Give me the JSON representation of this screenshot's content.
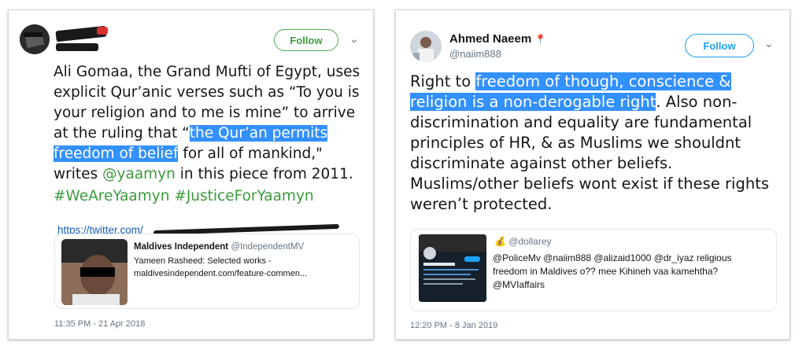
{
  "left_tweet": {
    "follow_label": "Follow",
    "text_parts": {
      "t1": "Ali Gomaa, the Grand Mufti of Egypt, uses explicit Qur’anic verses such as “To you is your religion and to me is mine” to arrive at the ruling that “",
      "highlight": "the Qur’an permits freedom of belief",
      "t2": " for all of mankind,\" writes ",
      "mention": "@yaamyn",
      "t3": " in this piece from 2011."
    },
    "hashtags": "#WeAreYaamyn #JusticeForYaamyn",
    "link": "https://twitter.com/",
    "card": {
      "title": "Maldives Independent",
      "handle": "@IndependentMV",
      "line1": "Yameen Rasheed: Selected works -",
      "line2": "maldivesindependent.com/feature-commen..."
    },
    "timestamp": "11:35 PM - 21 Apr 2018"
  },
  "right_tweet": {
    "name": "Ahmed Naeem",
    "pin": "📍",
    "handle": "@naiim888",
    "follow_label": "Follow",
    "text_parts": {
      "t1": "Right to ",
      "highlight": "freedom of though, conscience & religion is a non-derogable right",
      "t2": ". Also non-discrimination and equality are fundamental principles of HR, & as Muslims we shouldnt discriminate against other beliefs. Muslims/other beliefs wont exist if these rights weren’t protected."
    },
    "quote": {
      "icon": "💰",
      "handle": "@dollarey",
      "text": "@PoliceMv @naiim888 @alizaid1000  @dr_iyaz  religious freedom in Maldives o?? mee Kihineh vaa kamehtha?  @MVIaffairs"
    },
    "timestamp": "12:20 PM - 8 Jan 2019"
  },
  "colors": {
    "highlight": "#3390ff",
    "follow_green": "#3c9b3c",
    "follow_blue": "#1da1f2"
  }
}
